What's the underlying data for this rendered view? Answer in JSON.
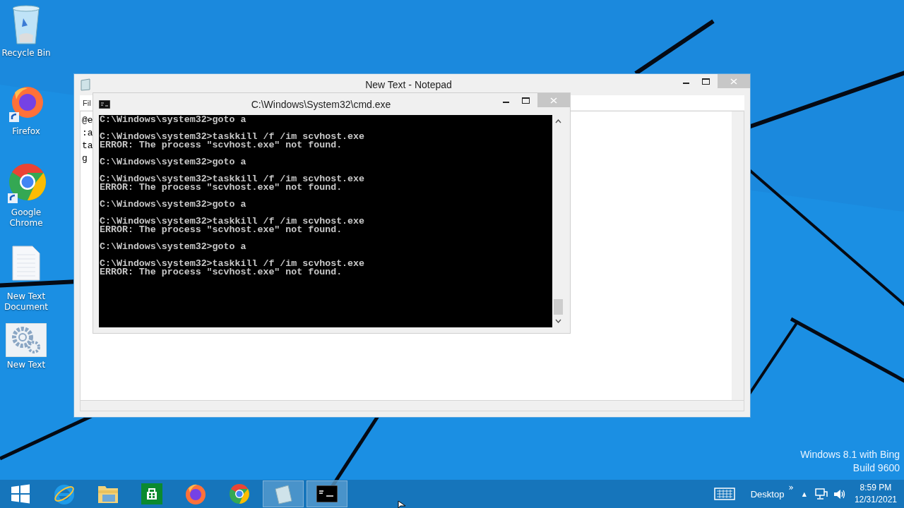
{
  "desktop_icons": [
    {
      "label": "Recycle Bin",
      "kind": "bin"
    },
    {
      "label": "Firefox",
      "kind": "firefox"
    },
    {
      "label": "Google Chrome",
      "kind": "chrome"
    },
    {
      "label": "New Text Document",
      "kind": "doc"
    },
    {
      "label": "New Text",
      "kind": "gear"
    }
  ],
  "notepad": {
    "title": "New Text  - Notepad",
    "menu": [
      "Fil"
    ],
    "lines": [
      "@e",
      ":a",
      "ta",
      "g"
    ]
  },
  "cmd": {
    "title": "C:\\Windows\\System32\\cmd.exe",
    "blocks": [
      {
        "lines": [
          "C:\\Windows\\system32>goto a"
        ]
      },
      {
        "lines": [
          "C:\\Windows\\system32>taskkill /f /im scvhost.exe",
          "ERROR: The process \"scvhost.exe\" not found."
        ]
      },
      {
        "lines": [
          "C:\\Windows\\system32>goto a"
        ]
      },
      {
        "lines": [
          "C:\\Windows\\system32>taskkill /f /im scvhost.exe",
          "ERROR: The process \"scvhost.exe\" not found."
        ]
      },
      {
        "lines": [
          "C:\\Windows\\system32>goto a"
        ]
      },
      {
        "lines": [
          "C:\\Windows\\system32>taskkill /f /im scvhost.exe",
          "ERROR: The process \"scvhost.exe\" not found."
        ]
      },
      {
        "lines": [
          "C:\\Windows\\system32>goto a"
        ]
      },
      {
        "lines": [
          "C:\\Windows\\system32>taskkill /f /im scvhost.exe",
          "ERROR: The process \"scvhost.exe\" not found."
        ]
      }
    ]
  },
  "os_watermark": [
    "Windows 8.1 with Bing",
    "Build 9600"
  ],
  "taskbar": {
    "items": [
      {
        "kind": "start",
        "active": false
      },
      {
        "kind": "ie",
        "active": false
      },
      {
        "kind": "explorer",
        "active": false
      },
      {
        "kind": "store",
        "active": false
      },
      {
        "kind": "firefox",
        "active": false
      },
      {
        "kind": "chrome",
        "active": false
      },
      {
        "kind": "notepad",
        "active": true
      },
      {
        "kind": "cmd",
        "active": true
      }
    ],
    "toolbar_label": "Desktop",
    "toolbar_more": "»",
    "tray_caret": "▲",
    "time": "8:59 PM",
    "date": "12/31/2021"
  }
}
